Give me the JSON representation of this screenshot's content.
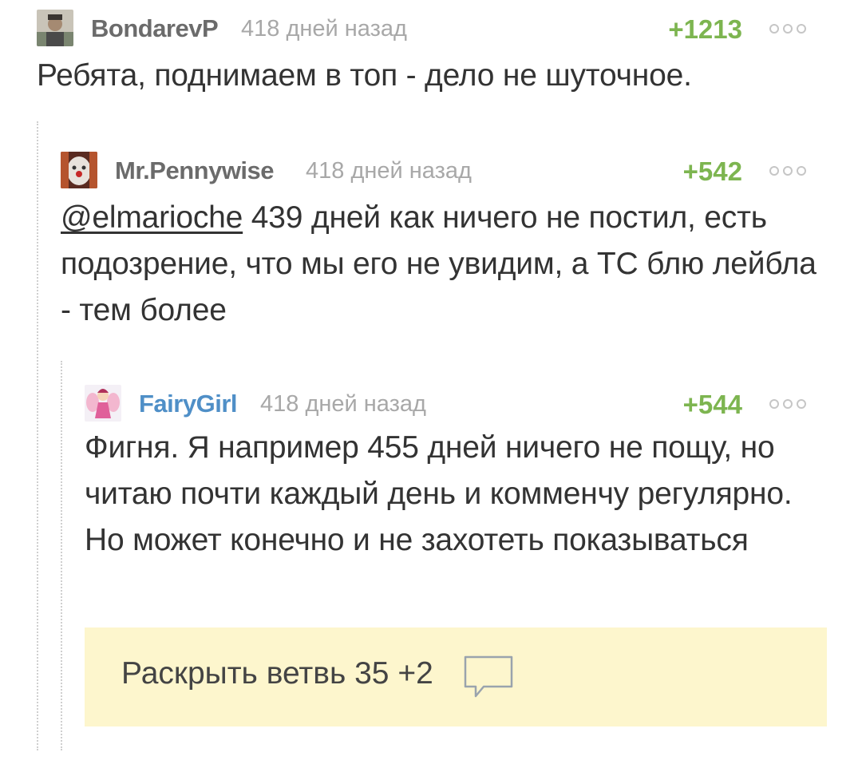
{
  "comments": [
    {
      "nick": "BondarevP",
      "nick_color": "#6b6b6b",
      "time": "418 дней назад",
      "rating": "+1213",
      "text": "Ребята, поднимаем в топ - дело не шуточное."
    },
    {
      "nick": "Mr.Pennywise",
      "nick_color": "#6b6b6b",
      "time": "418 дней назад",
      "rating": "+542",
      "mention": "@elmarioche",
      "text": " 439 дней как ничего не постил, есть подозрение, что мы его не увидим, а ТС блю лейбла - тем более"
    },
    {
      "nick": "FairyGirl",
      "nick_color": "#4f8fc7",
      "time": "418 дней назад",
      "rating": "+544",
      "text": "Фигня. Я например 455 дней ничего не пощу, но читаю почти каждый день и комменчу регулярно. Но может конечно и не захотеть показываться"
    }
  ],
  "expand_branch": {
    "label": "Раскрыть ветвь 35 +2",
    "icon": "comment-bubble-icon"
  },
  "icons": {
    "more": "more-dots-icon"
  },
  "colors": {
    "rating": "#7db550",
    "expand_bg": "#fdf6cd",
    "time": "#a8a8a8"
  }
}
